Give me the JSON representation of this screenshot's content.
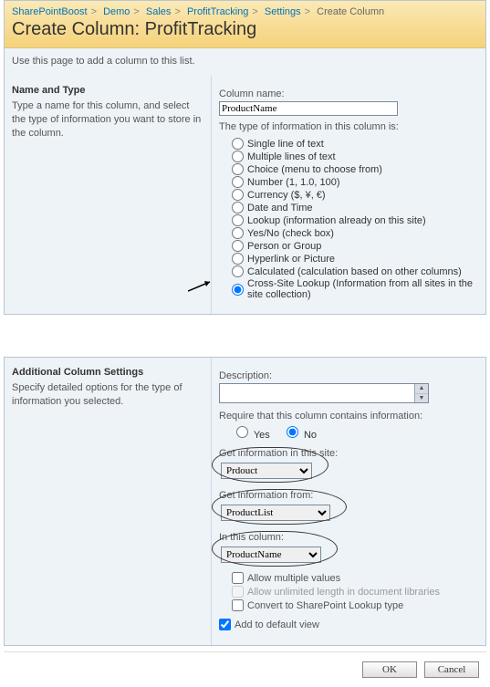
{
  "breadcrumb": [
    "SharePointBoost",
    "Demo",
    "Sales",
    "ProfitTracking",
    "Settings",
    "Create Column"
  ],
  "page_title": "Create Column: ProfitTracking",
  "intro": "Use this page to add a column to this list.",
  "section1": {
    "heading": "Name and Type",
    "desc": "Type a name for this column, and select the type of information you want to store in the column.",
    "colname_label": "Column name:",
    "colname_value": "ProductName",
    "type_intro": "The type of information in this column is:",
    "types": [
      "Single line of text",
      "Multiple lines of text",
      "Choice (menu to choose from)",
      "Number (1, 1.0, 100)",
      "Currency ($, ¥, €)",
      "Date and Time",
      "Lookup (information already on this site)",
      "Yes/No (check box)",
      "Person or Group",
      "Hyperlink or Picture",
      "Calculated (calculation based on other columns)",
      "Cross-Site Lookup (Information from all sites in the site collection)"
    ],
    "selected_type_index": 11
  },
  "section2": {
    "heading": "Additional Column Settings",
    "desc": "Specify detailed options for the type of information you selected.",
    "description_label": "Description:",
    "require_label": "Require that this column contains information:",
    "yes": "Yes",
    "no": "No",
    "require_value": "No",
    "site_label": "Get information in this site:",
    "site_value": "Prdouct",
    "from_label": "Get information from:",
    "from_value": "ProductList",
    "col_label": "In this column:",
    "col_value": "ProductName",
    "allow_multi": "Allow multiple values",
    "allow_unlimited": "Allow unlimited length in document libraries",
    "convert": "Convert to SharePoint Lookup type",
    "add_default": "Add to default view",
    "add_default_checked": true
  },
  "buttons": {
    "ok": "OK",
    "cancel": "Cancel"
  }
}
